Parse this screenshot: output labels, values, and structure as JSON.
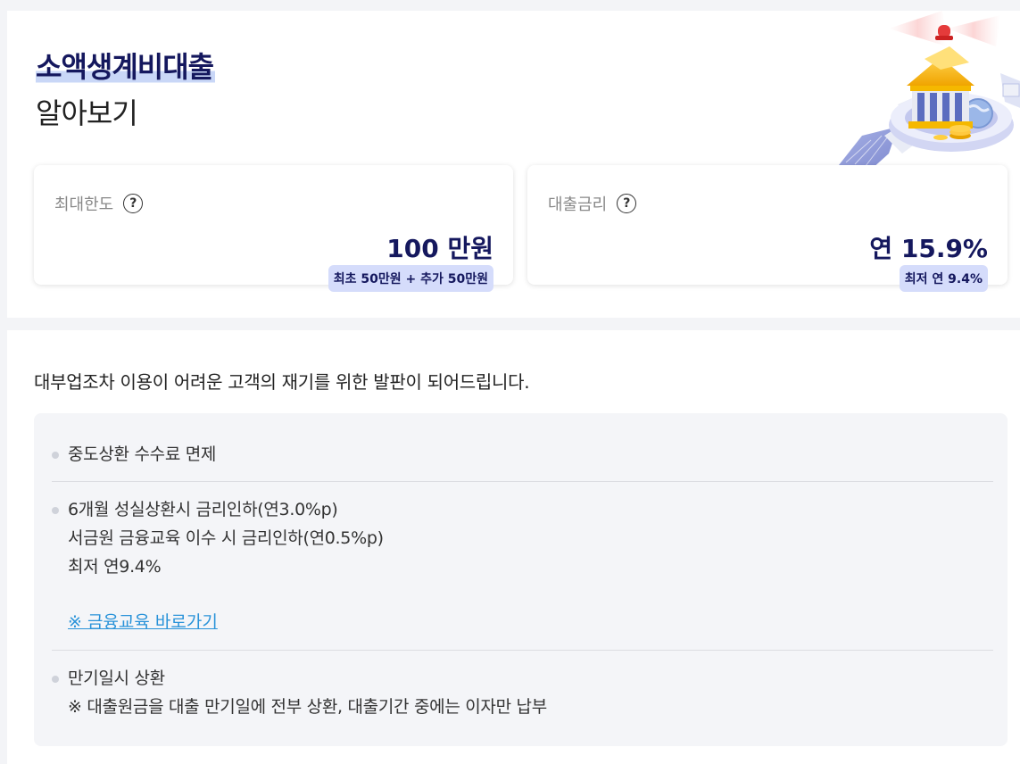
{
  "header": {
    "title": "소액생계비대출",
    "subtitle": "알아보기"
  },
  "cards": [
    {
      "label": "최대한도",
      "value": "100 만원",
      "badge": "최초 50만원 + 추가 50만원",
      "help_icon": "?"
    },
    {
      "label": "대출금리",
      "value": "연 15.9%",
      "badge": "최저 연 9.4%",
      "help_icon": "?"
    }
  ],
  "intro": "대부업조차 이용이 어려운 고객의 재기를 위한 발판이 되어드립니다.",
  "features": [
    {
      "lines": [
        "중도상환 수수료 면제"
      ]
    },
    {
      "lines": [
        "6개월 성실상환시 금리인하(연3.0%p)",
        "서금원 금융교육 이수 시 금리인하(연0.5%p)",
        "최저 연9.4%"
      ],
      "link": "※ 금융교육 바로가기"
    },
    {
      "lines": [
        "만기일시 상환",
        "※ 대출원금을 대출 만기일에 전부 상환, 대출기간 중에는 이자만 납부"
      ]
    }
  ],
  "colors": {
    "navy": "#15185e",
    "badge_bg": "#d5dcfb",
    "link": "#2a93d9",
    "highlight": "#c9d7f7"
  },
  "icons": {
    "help": "help-circle-icon",
    "illustration": "bank-siren-illustration"
  }
}
